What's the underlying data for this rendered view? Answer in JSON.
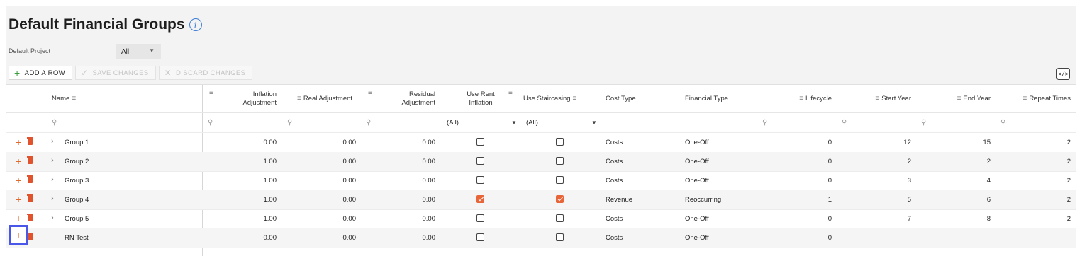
{
  "page": {
    "title": "Default Financial Groups",
    "info_icon": "info-circle-icon",
    "project_label": "Default Project",
    "project_value": "All"
  },
  "toolbar": {
    "add_row": "ADD A ROW",
    "save_changes": "SAVE CHANGES",
    "discard_changes": "DISCARD CHANGES",
    "code_icon": "code-export-icon"
  },
  "columns": {
    "name": "Name",
    "inflation_1": "Inflation",
    "inflation_2": "Adjustment",
    "real_adjustment": "Real Adjustment",
    "residual_1": "Residual",
    "residual_2": "Adjustment",
    "use_rent_1": "Use Rent",
    "use_rent_2": "Inflation",
    "use_staircasing": "Use Staircasing",
    "cost_type": "Cost Type",
    "financial_type": "Financial Type",
    "lifecycle": "Lifecycle",
    "start_year": "Start Year",
    "end_year": "End Year",
    "repeat_times": "Repeat Times"
  },
  "filters": {
    "use_rent_inflation": "(All)",
    "use_staircasing": "(All)"
  },
  "rows": [
    {
      "name": "Group 1",
      "inflation": "0.00",
      "real": "0.00",
      "residual": "0.00",
      "use_rent": false,
      "use_stair": false,
      "cost_type": "Costs",
      "financial_type": "One-Off",
      "lifecycle": "0",
      "start_year": "12",
      "end_year": "15",
      "repeat_times": "2"
    },
    {
      "name": "Group 2",
      "inflation": "1.00",
      "real": "0.00",
      "residual": "0.00",
      "use_rent": false,
      "use_stair": false,
      "cost_type": "Costs",
      "financial_type": "One-Off",
      "lifecycle": "0",
      "start_year": "2",
      "end_year": "2",
      "repeat_times": "2"
    },
    {
      "name": "Group 3",
      "inflation": "1.00",
      "real": "0.00",
      "residual": "0.00",
      "use_rent": false,
      "use_stair": false,
      "cost_type": "Costs",
      "financial_type": "One-Off",
      "lifecycle": "0",
      "start_year": "3",
      "end_year": "4",
      "repeat_times": "2"
    },
    {
      "name": "Group 4",
      "inflation": "1.00",
      "real": "0.00",
      "residual": "0.00",
      "use_rent": true,
      "use_stair": true,
      "cost_type": "Revenue",
      "financial_type": "Reoccurring",
      "lifecycle": "1",
      "start_year": "5",
      "end_year": "6",
      "repeat_times": "2"
    },
    {
      "name": "Group 5",
      "inflation": "1.00",
      "real": "0.00",
      "residual": "0.00",
      "use_rent": false,
      "use_stair": false,
      "cost_type": "Costs",
      "financial_type": "One-Off",
      "lifecycle": "0",
      "start_year": "7",
      "end_year": "8",
      "repeat_times": "2"
    },
    {
      "name": "RN Test",
      "inflation": "0.00",
      "real": "0.00",
      "residual": "0.00",
      "use_rent": false,
      "use_stair": false,
      "cost_type": "Costs",
      "financial_type": "One-Off",
      "lifecycle": "0",
      "start_year": "",
      "end_year": "",
      "repeat_times": ""
    }
  ]
}
